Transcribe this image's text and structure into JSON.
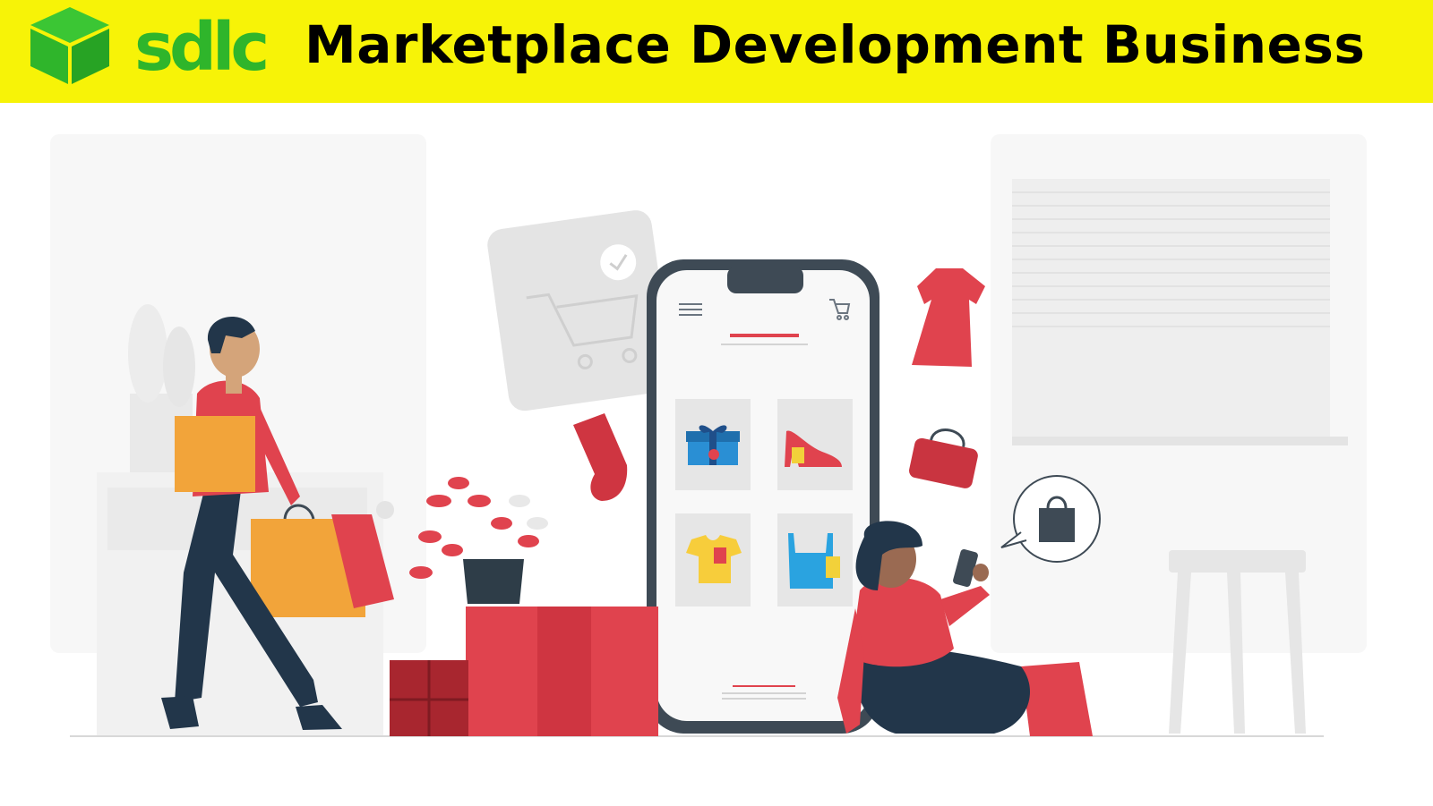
{
  "header": {
    "logo_text": "sdlc",
    "title": "Marketplace Development Business"
  },
  "colors": {
    "banner": "#f7f307",
    "brand_green": "#2fb52b",
    "accent_red": "#e0434e",
    "dark_navy": "#22364a",
    "orange_bag": "#f2a43a"
  },
  "illustration": {
    "phone_products": [
      "gift",
      "high-heel-shoe",
      "t-shirt",
      "top"
    ],
    "discount_tag": "%",
    "icons": [
      "cart-icon",
      "hamburger-menu-icon",
      "checkmark-icon",
      "shopping-bag-icon",
      "dress-icon",
      "sock-icon",
      "handbag-icon"
    ]
  }
}
